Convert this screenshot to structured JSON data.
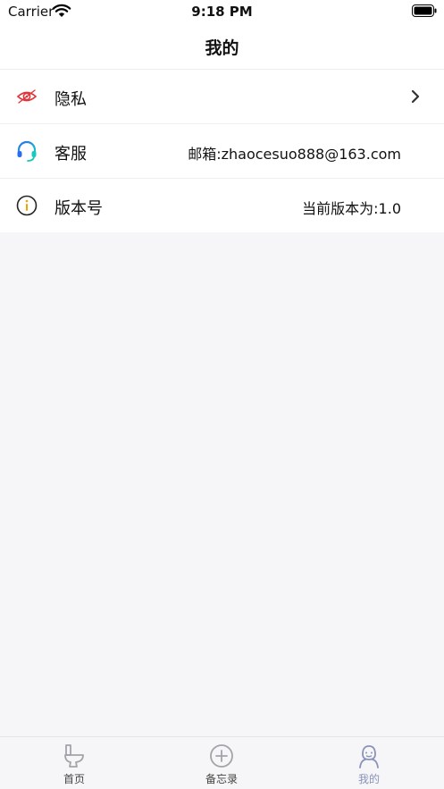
{
  "status_bar": {
    "carrier": "Carrier",
    "time": "9:18 PM"
  },
  "nav": {
    "title": "我的"
  },
  "rows": [
    {
      "label": "隐私",
      "icon": "eye-icon",
      "has_chevron": true
    },
    {
      "label": "客服",
      "icon": "headset-icon",
      "value": "邮箱:zhaocesuo888@163.com"
    },
    {
      "label": "版本号",
      "icon": "info-icon",
      "value": "当前版本为:1.0"
    }
  ],
  "tabs": [
    {
      "label": "首页",
      "icon": "toilet-icon"
    },
    {
      "label": "备忘录",
      "icon": "plus-circle-icon"
    },
    {
      "label": "我的",
      "icon": "person-icon",
      "active": true
    }
  ],
  "colors": {
    "active_tab": "#8a93b8",
    "eye_icon": "#e0353a",
    "headset_icon_start": "#2a6cf0",
    "headset_icon_end": "#18c9c0",
    "info_accent": "#f0a300"
  }
}
